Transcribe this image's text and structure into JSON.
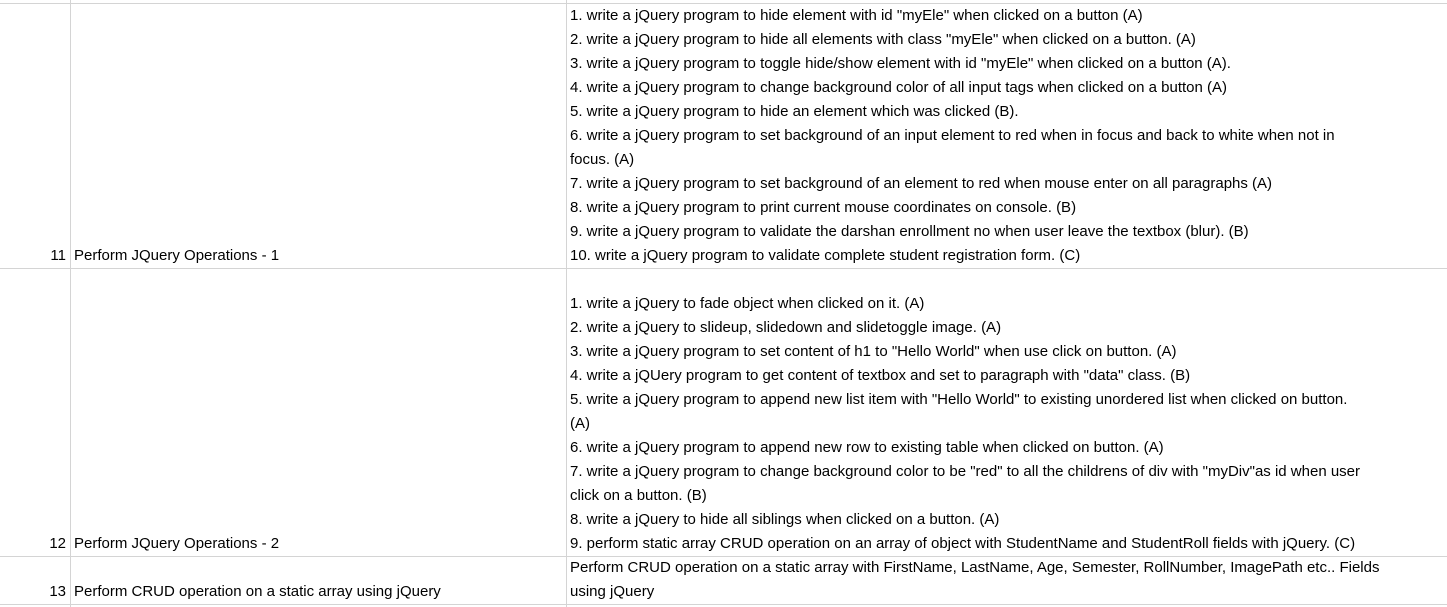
{
  "sheet": {
    "rows": [
      {
        "number": "11",
        "title": "Perform JQuery Operations - 1",
        "description_lines": [
          "1. write a jQuery program to hide element with id \"myEle\" when clicked on a button (A)",
          "2. write a jQuery program to hide all elements with class \"myEle\" when clicked on a button. (A)",
          "3. write a jQuery program to toggle hide/show element with id \"myEle\" when clicked on a button (A).",
          "4. write a jQuery program to change background color of all input tags when clicked on a button (A)",
          "5. write a jQuery program to hide an element which was clicked (B).",
          "6. write a jQuery program to set background of an input element to red when in focus and back to white when not in",
          "focus. (A)",
          "7. write a jQuery program to set background of an element to red when mouse enter on all paragraphs (A)",
          "8. write a jQuery program to print current mouse coordinates on console. (B)",
          "9. write a jQuery program to validate the darshan enrollment no when user leave the textbox (blur). (B)",
          "10. write a jQuery program to validate complete student registration form. (C)"
        ]
      },
      {
        "number": "12",
        "title": "Perform JQuery Operations - 2",
        "description_lines": [
          "",
          "1. write a jQuery to fade object when clicked on it. (A)",
          "2. write a jQuery to slideup, slidedown and slidetoggle image. (A)",
          "3. write a jQuery program to set content of h1 to \"Hello World\" when use click on button. (A)",
          "4. write a jQUery program to get content of textbox and set to paragraph with \"data\" class. (B)",
          "5. write a jQuery program to append new list item with \"Hello World\" to existing unordered list when clicked on button.",
          "(A)",
          "6. write a jQuery program to append new row to existing table when clicked on button. (A)",
          "7. write a jQuery program to change background color to be \"red\" to all the childrens of div with \"myDiv\"as id when user",
          "click on a button. (B)",
          "8. write a jQuery to hide all siblings when clicked on a button. (A)",
          "9. perform static array CRUD operation on an array of object with StudentName and StudentRoll fields with jQuery. (C)"
        ]
      },
      {
        "number": "13",
        "title": "Perform CRUD operation on a static array using jQuery",
        "description_lines": [
          "Perform CRUD operation on a static array with FirstName, LastName, Age, Semester, RollNumber, ImagePath etc.. Fields",
          "using jQuery"
        ]
      }
    ]
  }
}
